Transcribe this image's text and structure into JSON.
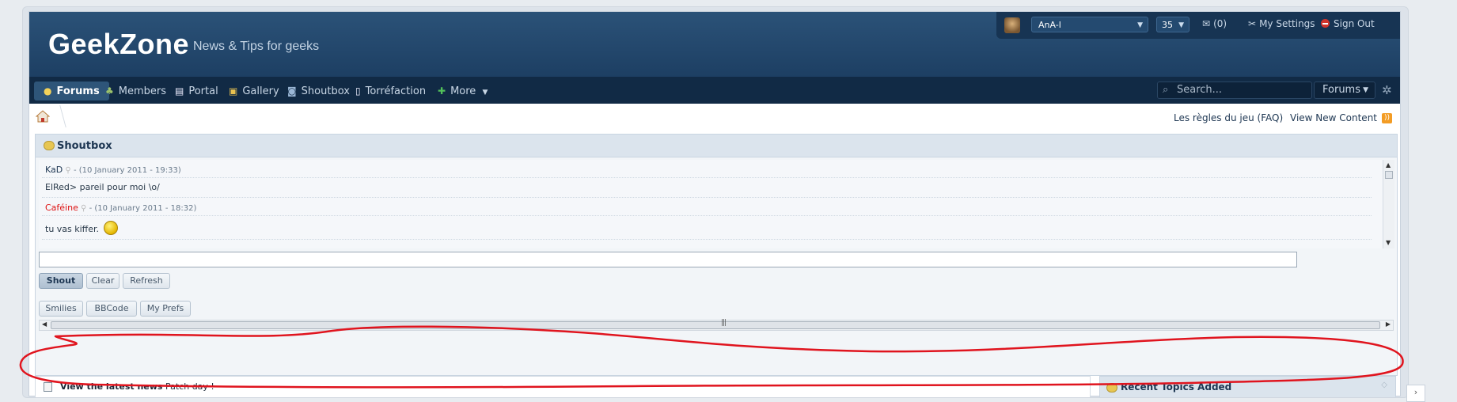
{
  "site": {
    "logo": "GeekZone",
    "tagline": "News & Tips for geeks"
  },
  "userbar": {
    "username": "AnA-l",
    "count_select": "35",
    "messages_label": "(0)",
    "settings_label": "My Settings",
    "signout_label": "Sign Out"
  },
  "nav": {
    "items": [
      {
        "label": "Forums",
        "icon": "forums-icon",
        "active": true
      },
      {
        "label": "Members",
        "icon": "members-icon"
      },
      {
        "label": "Portal",
        "icon": "portal-icon"
      },
      {
        "label": "Gallery",
        "icon": "gallery-icon"
      },
      {
        "label": "Shoutbox",
        "icon": "shoutbox-icon"
      },
      {
        "label": "Torréfaction",
        "icon": "page-icon"
      },
      {
        "label": "More",
        "icon": "plus-icon"
      }
    ],
    "search_placeholder": "Search...",
    "search_scope": "Forums"
  },
  "top_links": {
    "faq": "Les règles du jeu (FAQ)",
    "new_content": "View New Content"
  },
  "shoutbox": {
    "title": "Shoutbox",
    "messages": [
      {
        "user": "KaD",
        "meta": "- (10 January 2011 - 19:33)",
        "text": "ElRed> pareil pour moi \\o/",
        "user_color": "#1d3652"
      },
      {
        "user": "Caféine",
        "meta": "- (10 January 2011 - 18:32)",
        "text": "tu vas kiffer.",
        "user_color": "#dd1111"
      }
    ],
    "buttons": {
      "shout": "Shout",
      "clear": "Clear",
      "refresh": "Refresh",
      "smilies": "Smilies",
      "bbcode": "BBCode",
      "prefs": "My Prefs"
    }
  },
  "latest_news": {
    "label": "View the latest news",
    "text": "Patch day !"
  },
  "recent_topics": {
    "title": "Recent Topics Added"
  },
  "colors": {
    "header": "#1d3f63",
    "nav": "#112a45",
    "annotation": "#e0141e"
  }
}
